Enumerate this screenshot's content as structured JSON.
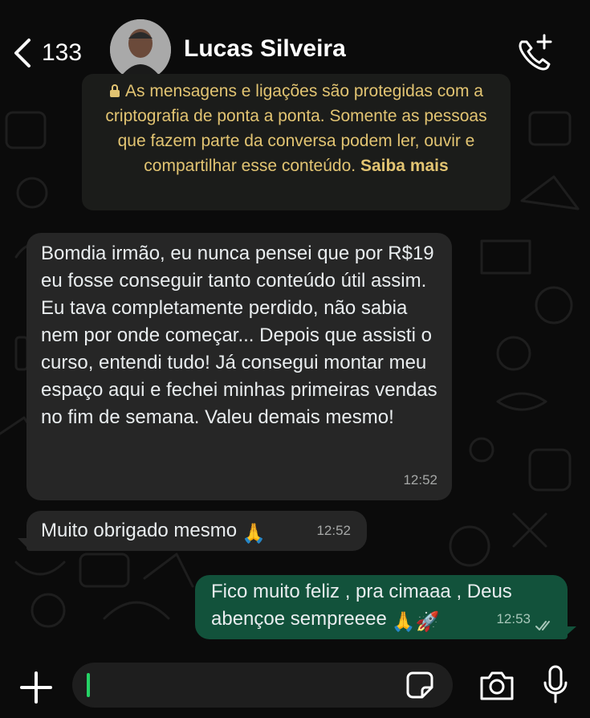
{
  "header": {
    "back_count": "133",
    "contact_name": "Lucas Silveira",
    "icons": {
      "back": "chevron-left-icon",
      "call": "phone-add-icon",
      "avatar": "avatar"
    }
  },
  "encryption_notice": {
    "text": "As mensagens e ligações são protegidas com a criptografia de ponta a ponta. Somente as pessoas que fazem parte da conversa podem ler, ouvir e compartilhar esse conteúdo.",
    "link": "Saiba mais",
    "color": "#e2c472"
  },
  "messages": [
    {
      "direction": "incoming",
      "text": "Bomdia irmão, eu nunca pensei que por R$19 eu fosse conseguir tanto conteúdo útil assim. Eu tava completamente perdido, não sabia nem por onde começar... Depois que assisti o curso, entendi tudo! Já consegui montar meu espaço aqui e fechei minhas primeiras vendas no fim de semana. Valeu demais mesmo!",
      "time": "12:52"
    },
    {
      "direction": "incoming",
      "text": "Muito obrigado mesmo",
      "emoji": "🙏",
      "time": "12:52"
    },
    {
      "direction": "outgoing",
      "text": "Fico muito feliz , pra cimaaa , Deus abençoe sempreeee",
      "emoji": "🙏🚀",
      "time": "12:53",
      "status": "read"
    }
  ],
  "input_bar": {
    "placeholder": "",
    "icons": [
      "plus-icon",
      "sticker-icon",
      "camera-icon",
      "microphone-icon"
    ]
  },
  "colors": {
    "background": "#0b0b0b",
    "incoming_bubble": "#262626",
    "outgoing_bubble": "#12523b",
    "accent": "#25d366"
  }
}
